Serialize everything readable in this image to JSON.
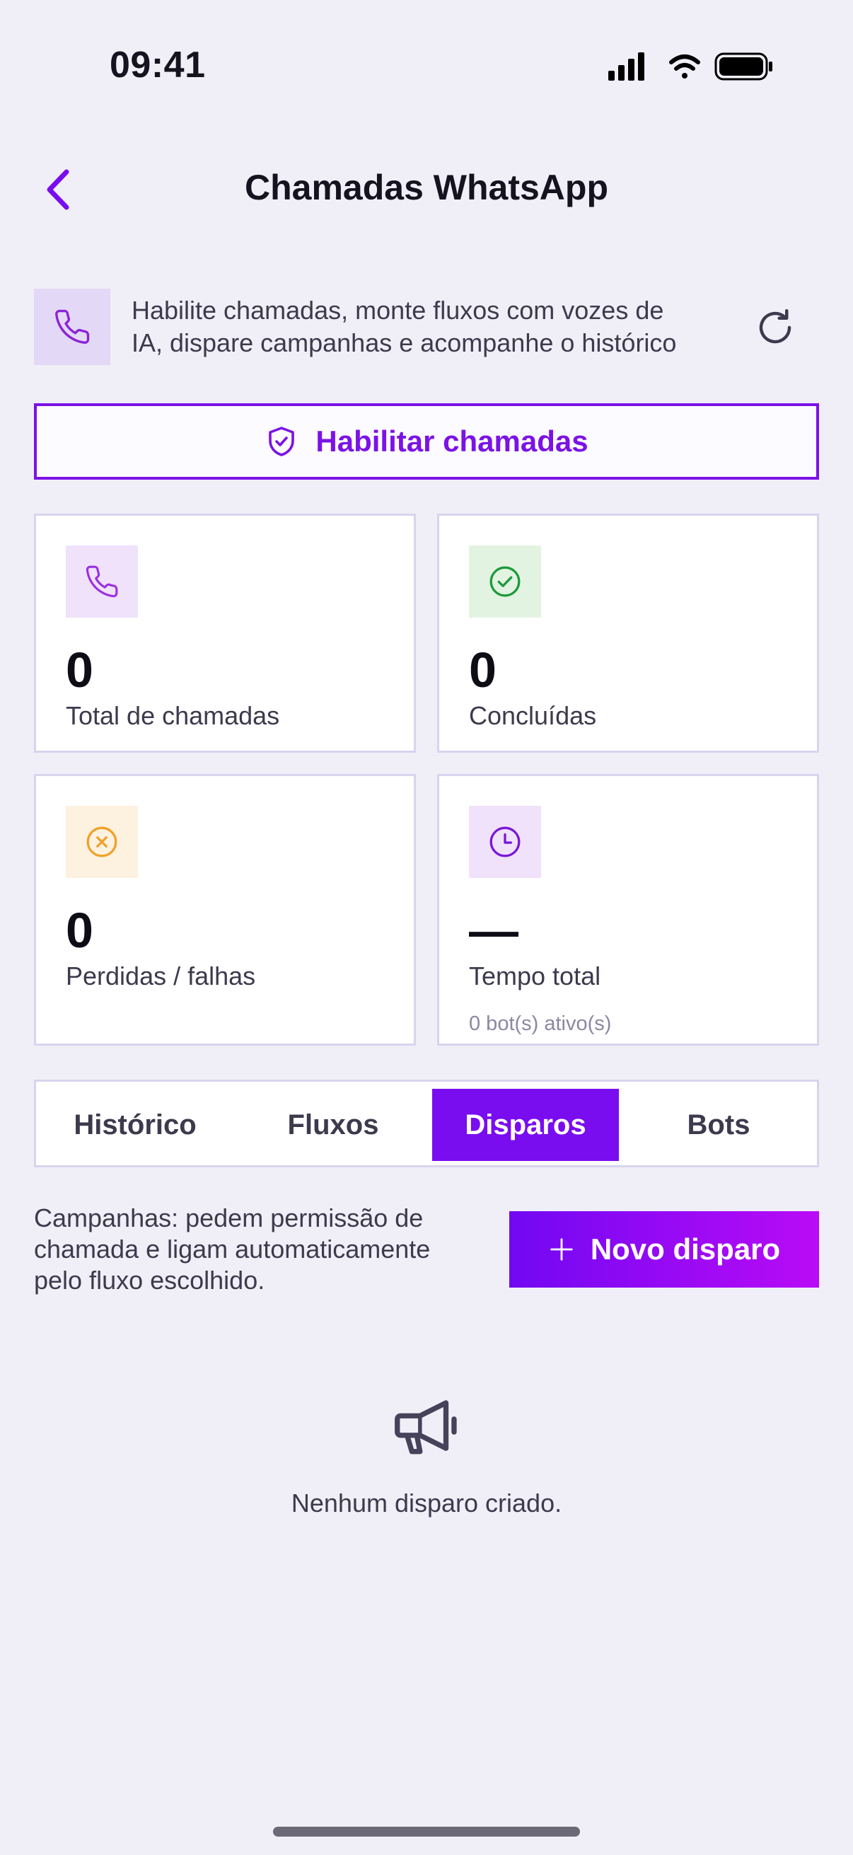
{
  "status_bar": {
    "time": "09:41"
  },
  "header": {
    "title": "Chamadas WhatsApp",
    "back_icon": "chevron-left-icon"
  },
  "info": {
    "line1": "Habilite chamadas, monte fluxos com vozes de",
    "line2": "IA, dispare campanhas e acompanhe o histórico",
    "icon": "phone-icon",
    "refresh_icon": "refresh-icon"
  },
  "enable_button": {
    "label": "Habilitar chamadas",
    "icon": "shield-check-icon"
  },
  "stats": [
    {
      "value": "0",
      "label": "Total de chamadas",
      "icon": "phone-icon",
      "color": "#9b2fe0"
    },
    {
      "value": "0",
      "label": "Concluídas",
      "icon": "check-circle-icon",
      "color": "#1f9a3a"
    },
    {
      "value": "0",
      "label": "Perdidas / falhas",
      "icon": "x-circle-icon",
      "color": "#f0a12a"
    },
    {
      "value": "—",
      "label": "Tempo total",
      "sublabel": "0 bot(s) ativo(s)",
      "icon": "clock-icon",
      "color": "#7a18d8"
    }
  ],
  "tabs": [
    {
      "label": "Histórico",
      "active": false
    },
    {
      "label": "Fluxos",
      "active": false
    },
    {
      "label": "Disparos",
      "active": true
    },
    {
      "label": "Bots",
      "active": false
    }
  ],
  "campaigns": {
    "description_line1": "Campanhas: pedem permissão de",
    "description_line2": "chamada e ligam automaticamente",
    "description_line3": "pelo fluxo escolhido.",
    "new_button_label": "Novo disparo",
    "new_button_icon": "plus-icon"
  },
  "empty_state": {
    "icon": "megaphone-icon",
    "text": "Nenhum disparo criado."
  },
  "colors": {
    "accent": "#7a0cf0",
    "background": "#f0eff7"
  }
}
